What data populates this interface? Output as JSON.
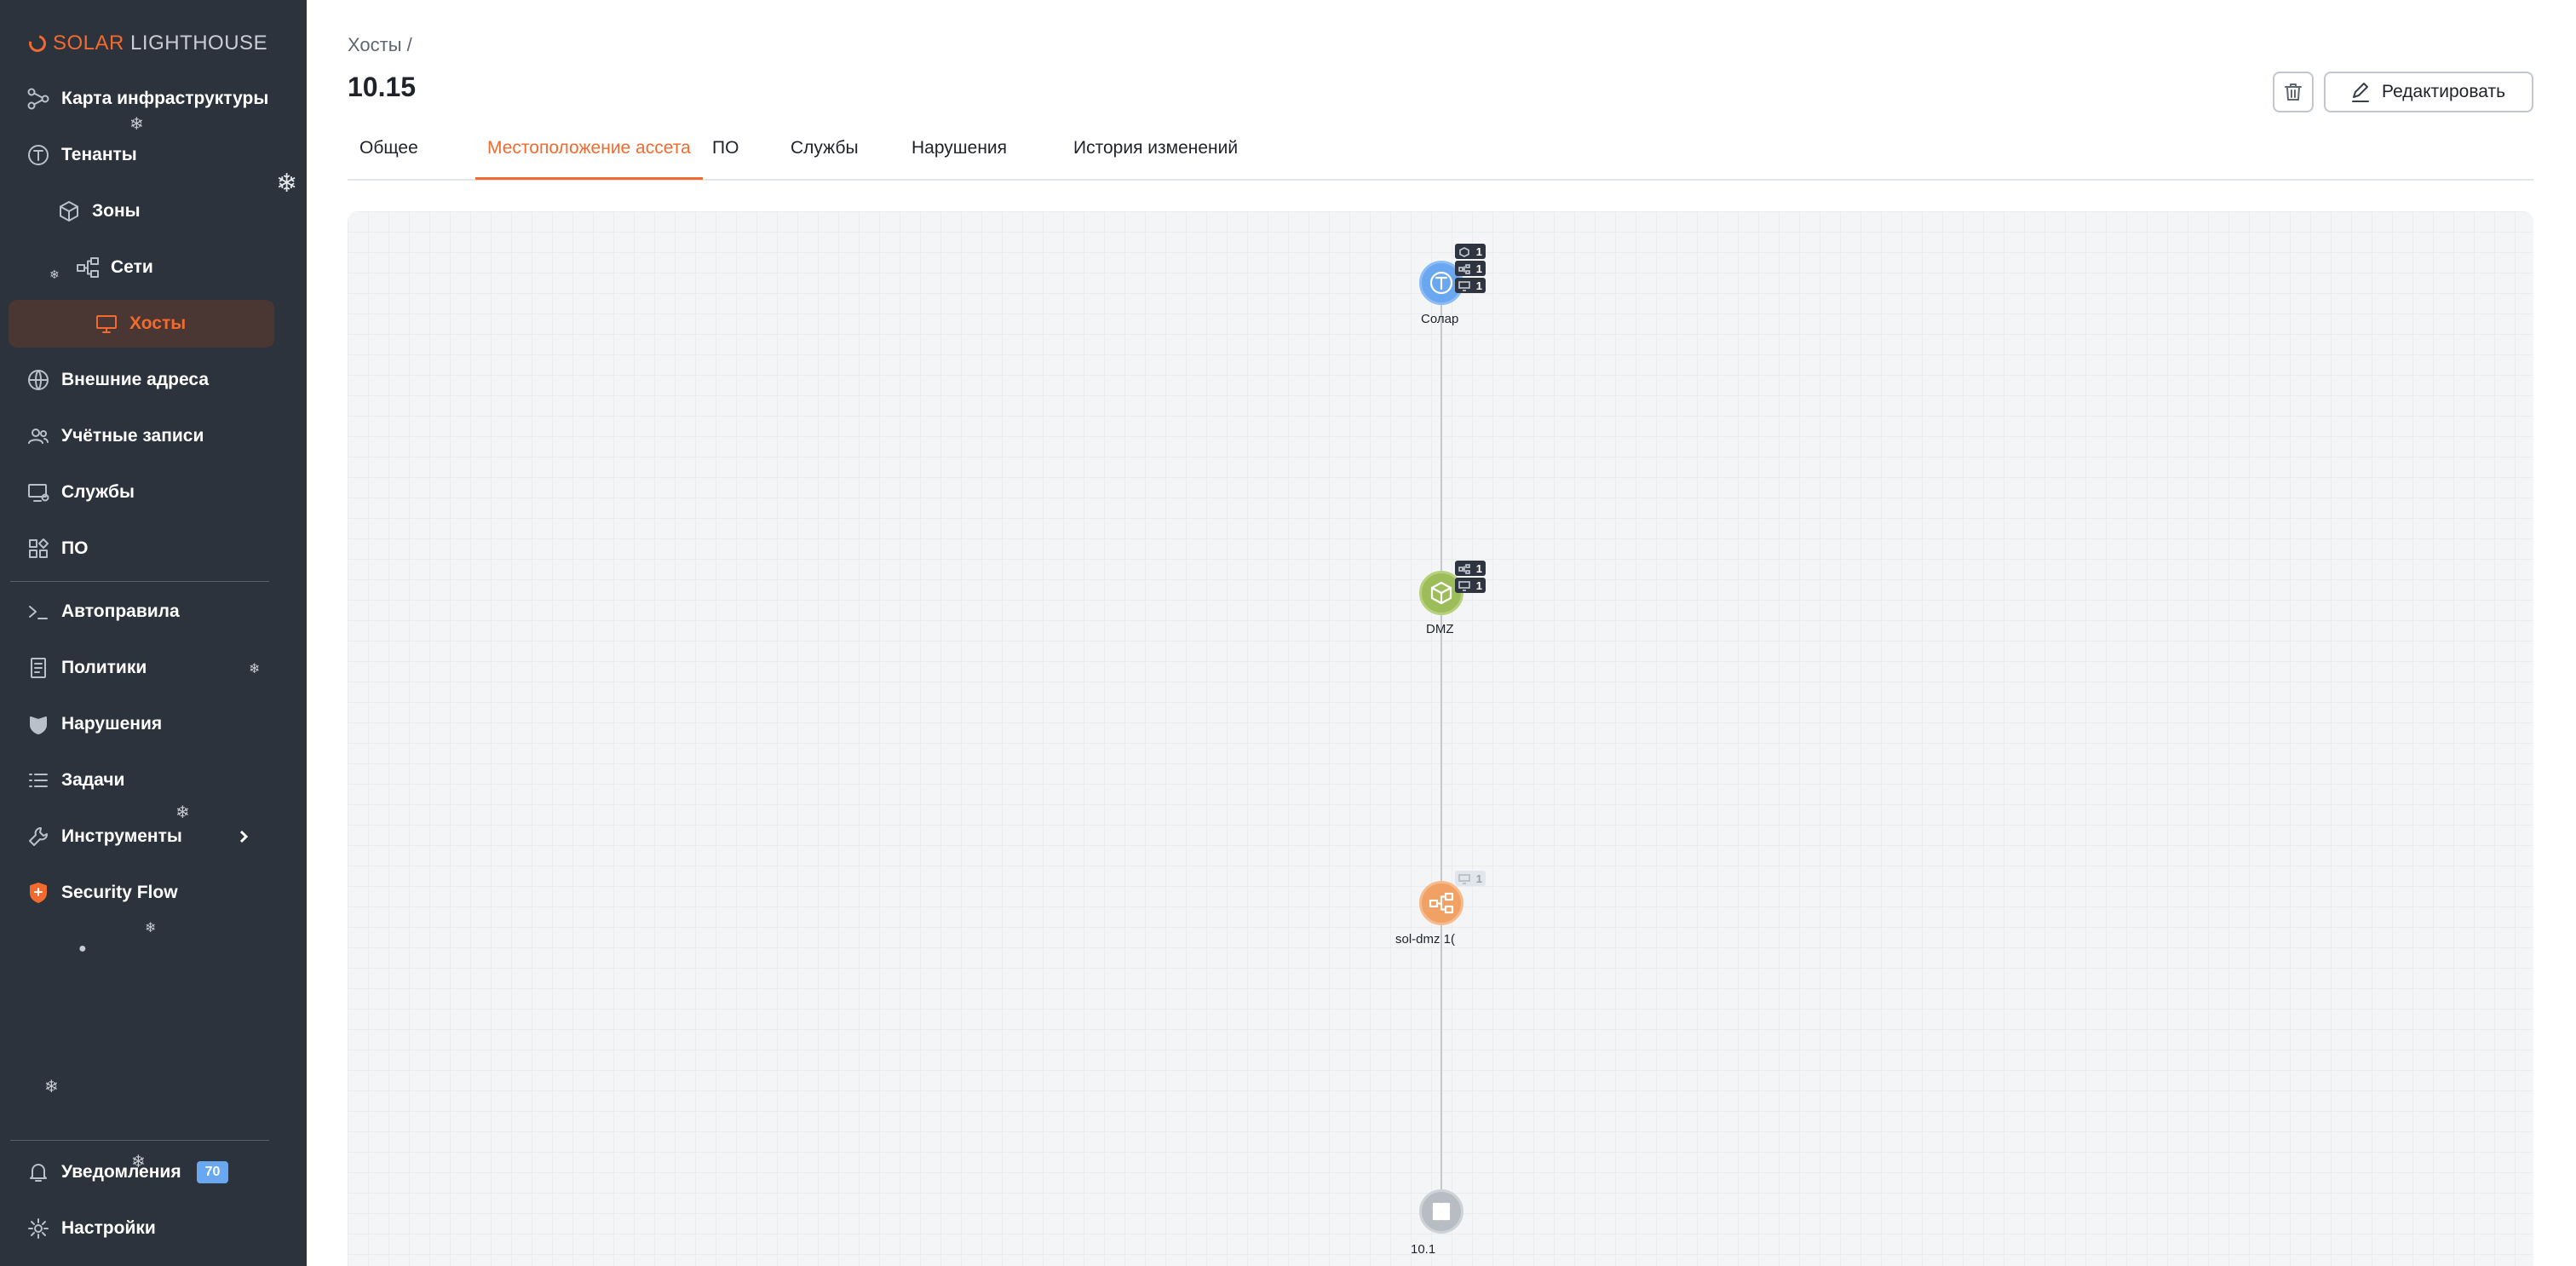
{
  "app": {
    "brand_primary": "SOLAR",
    "brand_secondary": "LIGHTHOUSE",
    "accent_color": "#f26a2e"
  },
  "sidebar": {
    "items": [
      {
        "label": "Карта инфраструктуры",
        "icon": "graph-icon"
      },
      {
        "label": "Тенанты",
        "icon": "tenant-icon"
      },
      {
        "label": "Зоны",
        "icon": "cube-icon"
      },
      {
        "label": "Сети",
        "icon": "network-icon"
      },
      {
        "label": "Хосты",
        "icon": "monitor-icon",
        "active": true
      },
      {
        "label": "Внешние адреса",
        "icon": "globe-icon"
      },
      {
        "label": "Учётные записи",
        "icon": "users-icon"
      },
      {
        "label": "Службы",
        "icon": "service-icon"
      },
      {
        "label": "ПО",
        "icon": "apps-icon"
      },
      {
        "label": "Автоправила",
        "icon": "terminal-icon"
      },
      {
        "label": "Политики",
        "icon": "document-icon"
      },
      {
        "label": "Нарушения",
        "icon": "violation-icon"
      },
      {
        "label": "Задачи",
        "icon": "list-icon"
      },
      {
        "label": "Инструменты",
        "icon": "wrench-icon"
      },
      {
        "label": "Security Flow",
        "icon": "shield-icon"
      }
    ],
    "notifications": {
      "label": "Уведомления",
      "count": "70",
      "badge_color": "#6aa7f1"
    },
    "settings": {
      "label": "Настройки"
    }
  },
  "header": {
    "breadcrumb": "Хосты /",
    "title": "10.15",
    "edit_label": "Редактировать"
  },
  "tabs": [
    {
      "label": "Общее"
    },
    {
      "label": "Местоположение ассета",
      "active": true
    },
    {
      "label": "ПО"
    },
    {
      "label": "Службы"
    },
    {
      "label": "Нарушения"
    },
    {
      "label": "История изменений"
    }
  ],
  "diagram": {
    "nodes": [
      {
        "label": "Солар",
        "type": "tenant",
        "color": "#6aa7f1",
        "counters": [
          "1",
          "1",
          "1"
        ]
      },
      {
        "label": "DMZ",
        "type": "zone",
        "color": "#9dbd5b",
        "counters": [
          "1",
          "1"
        ]
      },
      {
        "label": "sol-dmz 1(",
        "type": "network",
        "color": "#f0a163",
        "counters": [
          "1"
        ]
      },
      {
        "label": "10.1",
        "type": "host",
        "color": "#b8bdc4",
        "counters": []
      }
    ]
  }
}
